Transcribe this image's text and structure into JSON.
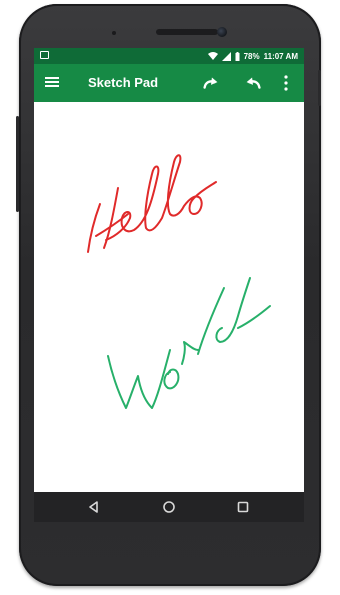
{
  "app": {
    "title": "Sketch Pad"
  },
  "status_bar": {
    "battery_percent": "78%",
    "time": "11:07 AM"
  },
  "toolbar": {
    "menu_icon": "hamburger-menu-icon",
    "redo_icon": "redo-icon",
    "undo_icon": "undo-icon",
    "overflow_icon": "more-vertical-icon"
  },
  "nav_bar": {
    "back_icon": "back-triangle-icon",
    "home_icon": "home-circle-icon",
    "recents_icon": "recents-square-icon"
  },
  "colors": {
    "status_bar": "#0f6b37",
    "toolbar": "#168a45",
    "ink_red": "#e02a2a",
    "ink_green": "#27b06a"
  }
}
